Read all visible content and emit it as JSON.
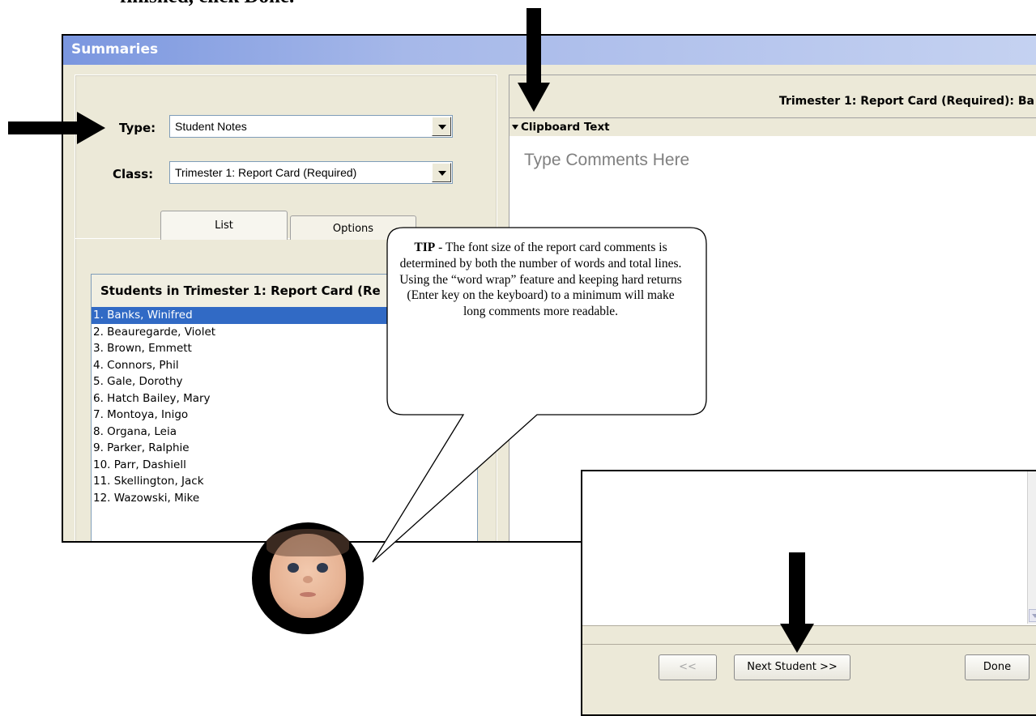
{
  "caption": "finished, click Done.",
  "window": {
    "title": "Summaries"
  },
  "form": {
    "type_label": "Type:",
    "type_value": "Student Notes",
    "class_label": "Class:",
    "class_value": "Trimester 1: Report Card (Required)"
  },
  "tabs": [
    {
      "label": "List"
    },
    {
      "label": "Options"
    }
  ],
  "student_list": {
    "header": "Students in Trimester 1: Report Card (Re",
    "items": [
      "1. Banks, Winifred",
      "2. Beauregarde, Violet",
      "3. Brown, Emmett",
      "4. Connors, Phil",
      "5. Gale, Dorothy",
      "6. Hatch Bailey, Mary",
      "7. Montoya, Inigo",
      "8. Organa, Leia",
      "9. Parker, Ralphie",
      "10. Parr, Dashiell",
      "11. Skellington, Jack",
      "12. Wazowski, Mike"
    ]
  },
  "right_panel": {
    "title": "Trimester 1: Report Card (Required): Ba",
    "clipboard_label": "Clipboard Text",
    "placeholder": "Type Comments Here"
  },
  "tip": {
    "bold": "TIP",
    "text": " - The font size of the report card comments is determined by both the number of words and total lines. Using the “word wrap” feature and keeping hard returns (Enter key on the keyboard) to a minimum will make long comments more readable."
  },
  "footer": {
    "prev_label": "<<",
    "next_label": "Next Student >>",
    "done_label": "Done"
  },
  "colors": {
    "selection": "#316ac5",
    "titlebar": "#7a96df",
    "panel": "#ece9d8"
  }
}
